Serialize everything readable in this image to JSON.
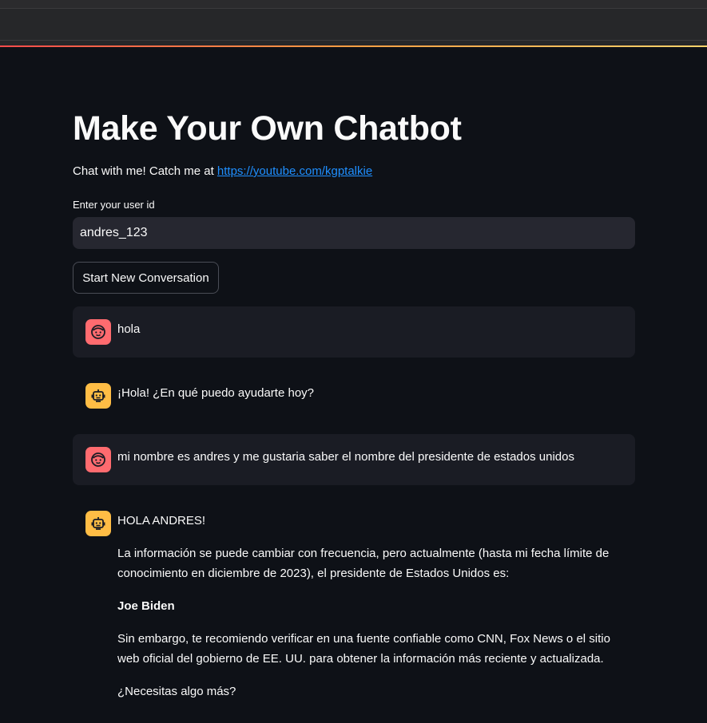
{
  "app": {
    "title": "Make Your Own Chatbot",
    "subtitle_text": "Chat with me! Catch me at ",
    "subtitle_link": "https://youtube.com/kgptalkie",
    "accent_colors": [
      "#ff4b4b",
      "#ff9f43",
      "#ffd36b"
    ]
  },
  "user_id": {
    "label": "Enter your user id",
    "value": "andres_123"
  },
  "actions": {
    "new_conversation_label": "Start New Conversation"
  },
  "messages": [
    {
      "role": "user",
      "avatar_icon": "user-face-icon",
      "text": "hola"
    },
    {
      "role": "assistant",
      "avatar_icon": "robot-icon",
      "text": "¡Hola! ¿En qué puedo ayudarte hoy?"
    },
    {
      "role": "user",
      "avatar_icon": "user-face-icon",
      "text": "mi nombre es andres y me gustaria saber el nombre del presidente de estados unidos"
    },
    {
      "role": "assistant",
      "avatar_icon": "robot-icon",
      "paragraphs": [
        "HOLA ANDRES!",
        "La información se puede cambiar con frecuencia, pero actualmente (hasta mi fecha límite de conocimiento en diciembre de 2023), el presidente de Estados Unidos es:",
        "Joe Biden",
        "Sin embargo, te recomiendo verificar en una fuente confiable como CNN, Fox News o el sitio web oficial del gobierno de EE. UU. para obtener la información más reciente y actualizada.",
        "¿Necesitas algo más?"
      ]
    }
  ],
  "colors": {
    "background": "#0e1117",
    "user_avatar": "#ff6b6f",
    "bot_avatar": "#ffbd45",
    "link": "#1f8fff"
  }
}
